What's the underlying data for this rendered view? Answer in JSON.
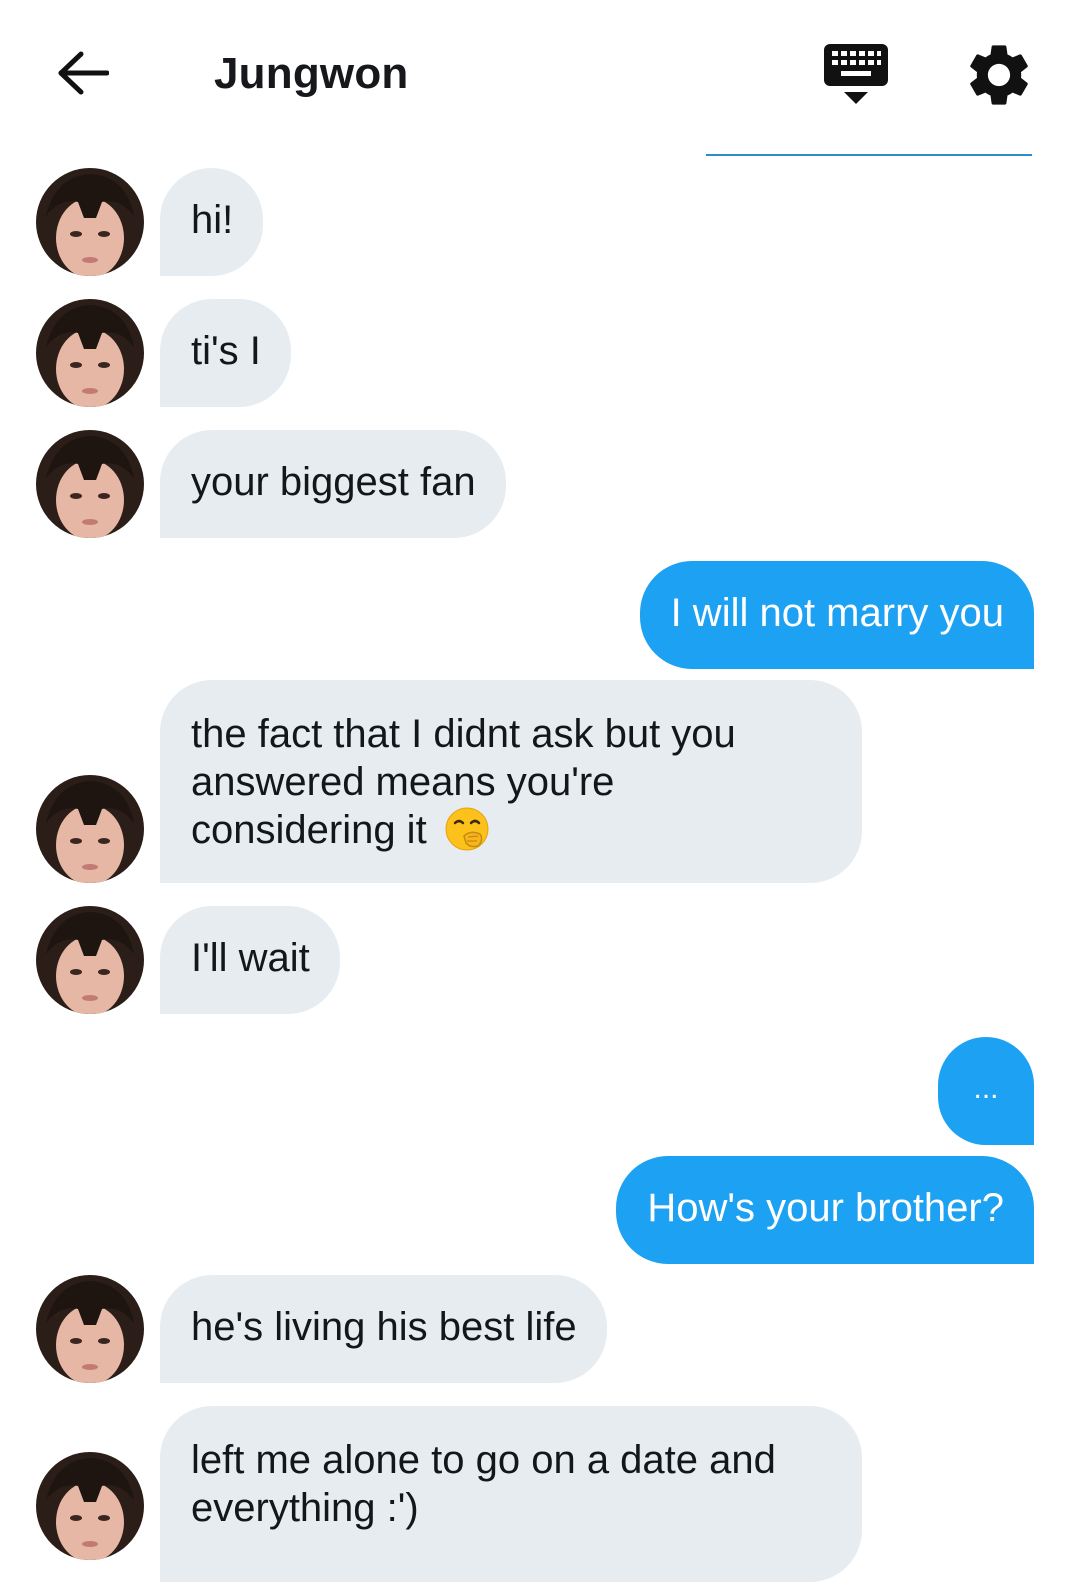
{
  "header": {
    "title": "Jungwon",
    "icons": {
      "back": "arrow-left-icon",
      "keyboard": "keyboard-hide-icon",
      "settings": "gear-icon"
    }
  },
  "colors": {
    "incoming_bubble": "#e6ecf0",
    "outgoing_bubble": "#1da1f2",
    "divider": "#2a8fc9"
  },
  "messages": [
    {
      "from": "them",
      "text": "hi!"
    },
    {
      "from": "them",
      "text": "ti's I"
    },
    {
      "from": "them",
      "text": "your biggest fan"
    },
    {
      "from": "me",
      "text": "I will not marry you"
    },
    {
      "from": "them",
      "lines": [
        "the fact that I didnt ask but you",
        "answered means you're",
        "considering it"
      ],
      "emoji": "🤭"
    },
    {
      "from": "them",
      "text": "I'll wait"
    },
    {
      "from": "me",
      "text": "..."
    },
    {
      "from": "me",
      "text": "How's your brother?"
    },
    {
      "from": "them",
      "text": "he's living his best life"
    },
    {
      "from": "them",
      "lines": [
        "left me alone to go on a date and",
        "everything :')"
      ]
    }
  ]
}
